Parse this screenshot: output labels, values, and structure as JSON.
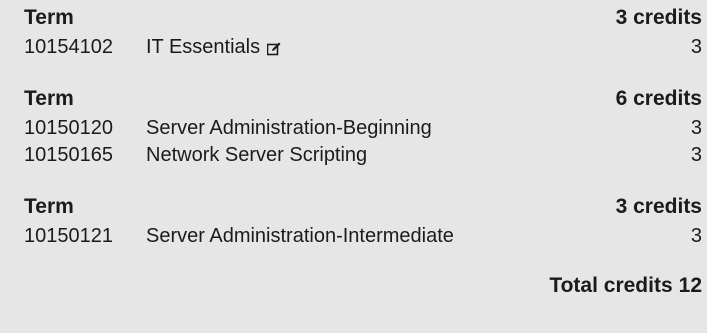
{
  "terms": [
    {
      "label": "Term",
      "credits": "3 credits",
      "courses": [
        {
          "code": "10154102",
          "name": "IT Essentials",
          "credits": "3",
          "icon": "edit-icon"
        }
      ]
    },
    {
      "label": "Term",
      "credits": "6 credits",
      "courses": [
        {
          "code": "10150120",
          "name": "Server Administration-Beginning",
          "credits": "3"
        },
        {
          "code": "10150165",
          "name": "Network Server Scripting",
          "credits": "3"
        }
      ]
    },
    {
      "label": "Term",
      "credits": "3 credits",
      "courses": [
        {
          "code": "10150121",
          "name": "Server Administration-Intermediate",
          "credits": "3"
        }
      ]
    }
  ],
  "total": {
    "label": "Total credits",
    "value": "12"
  }
}
